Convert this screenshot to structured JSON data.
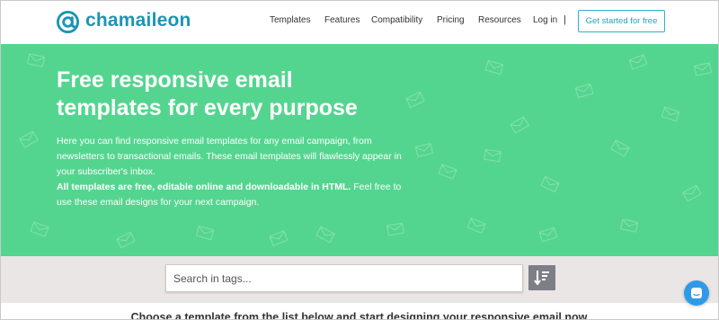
{
  "brand": {
    "name": "chamaileon",
    "logo_icon": "at-sign-icon",
    "color": "#1b95b5"
  },
  "nav": {
    "items": [
      "Templates",
      "Features",
      "Compatibility",
      "Pricing",
      "Resources",
      "Log in"
    ],
    "separator": "|",
    "cta_label": "Get started for free"
  },
  "hero": {
    "background_color": "#54d58f",
    "title_line1": "Free responsive email",
    "title_line2": "templates for every purpose",
    "paragraph1": "Here you can find responsive email templates for any email campaign, from newsletters to transactional emails. These email templates will flawlessly appear in your subscriber's inbox.",
    "paragraph2_bold": "All templates are free, editable online and downloadable in HTML.",
    "paragraph2_rest": " Feel free to use these email designs for your next campaign.",
    "pattern_icon": "envelope-icon"
  },
  "search": {
    "placeholder": "Search in tags...",
    "value": "",
    "sort_icon": "sort-descending-icon"
  },
  "footer_prompt": "Choose a template from the list below and start designing your responsive email now.",
  "chat": {
    "icon": "chat-icon",
    "color": "#2f9be8"
  }
}
